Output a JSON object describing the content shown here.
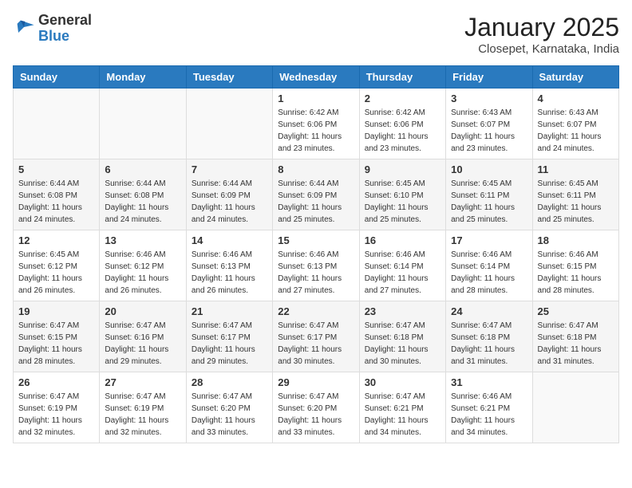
{
  "header": {
    "logo_general": "General",
    "logo_blue": "Blue",
    "main_title": "January 2025",
    "subtitle": "Closepet, Karnataka, India"
  },
  "days_of_week": [
    "Sunday",
    "Monday",
    "Tuesday",
    "Wednesday",
    "Thursday",
    "Friday",
    "Saturday"
  ],
  "weeks": [
    [
      {
        "day": "",
        "sunrise": "",
        "sunset": "",
        "daylight": ""
      },
      {
        "day": "",
        "sunrise": "",
        "sunset": "",
        "daylight": ""
      },
      {
        "day": "",
        "sunrise": "",
        "sunset": "",
        "daylight": ""
      },
      {
        "day": "1",
        "sunrise": "Sunrise: 6:42 AM",
        "sunset": "Sunset: 6:06 PM",
        "daylight": "Daylight: 11 hours and 23 minutes."
      },
      {
        "day": "2",
        "sunrise": "Sunrise: 6:42 AM",
        "sunset": "Sunset: 6:06 PM",
        "daylight": "Daylight: 11 hours and 23 minutes."
      },
      {
        "day": "3",
        "sunrise": "Sunrise: 6:43 AM",
        "sunset": "Sunset: 6:07 PM",
        "daylight": "Daylight: 11 hours and 23 minutes."
      },
      {
        "day": "4",
        "sunrise": "Sunrise: 6:43 AM",
        "sunset": "Sunset: 6:07 PM",
        "daylight": "Daylight: 11 hours and 24 minutes."
      }
    ],
    [
      {
        "day": "5",
        "sunrise": "Sunrise: 6:44 AM",
        "sunset": "Sunset: 6:08 PM",
        "daylight": "Daylight: 11 hours and 24 minutes."
      },
      {
        "day": "6",
        "sunrise": "Sunrise: 6:44 AM",
        "sunset": "Sunset: 6:08 PM",
        "daylight": "Daylight: 11 hours and 24 minutes."
      },
      {
        "day": "7",
        "sunrise": "Sunrise: 6:44 AM",
        "sunset": "Sunset: 6:09 PM",
        "daylight": "Daylight: 11 hours and 24 minutes."
      },
      {
        "day": "8",
        "sunrise": "Sunrise: 6:44 AM",
        "sunset": "Sunset: 6:09 PM",
        "daylight": "Daylight: 11 hours and 25 minutes."
      },
      {
        "day": "9",
        "sunrise": "Sunrise: 6:45 AM",
        "sunset": "Sunset: 6:10 PM",
        "daylight": "Daylight: 11 hours and 25 minutes."
      },
      {
        "day": "10",
        "sunrise": "Sunrise: 6:45 AM",
        "sunset": "Sunset: 6:11 PM",
        "daylight": "Daylight: 11 hours and 25 minutes."
      },
      {
        "day": "11",
        "sunrise": "Sunrise: 6:45 AM",
        "sunset": "Sunset: 6:11 PM",
        "daylight": "Daylight: 11 hours and 25 minutes."
      }
    ],
    [
      {
        "day": "12",
        "sunrise": "Sunrise: 6:45 AM",
        "sunset": "Sunset: 6:12 PM",
        "daylight": "Daylight: 11 hours and 26 minutes."
      },
      {
        "day": "13",
        "sunrise": "Sunrise: 6:46 AM",
        "sunset": "Sunset: 6:12 PM",
        "daylight": "Daylight: 11 hours and 26 minutes."
      },
      {
        "day": "14",
        "sunrise": "Sunrise: 6:46 AM",
        "sunset": "Sunset: 6:13 PM",
        "daylight": "Daylight: 11 hours and 26 minutes."
      },
      {
        "day": "15",
        "sunrise": "Sunrise: 6:46 AM",
        "sunset": "Sunset: 6:13 PM",
        "daylight": "Daylight: 11 hours and 27 minutes."
      },
      {
        "day": "16",
        "sunrise": "Sunrise: 6:46 AM",
        "sunset": "Sunset: 6:14 PM",
        "daylight": "Daylight: 11 hours and 27 minutes."
      },
      {
        "day": "17",
        "sunrise": "Sunrise: 6:46 AM",
        "sunset": "Sunset: 6:14 PM",
        "daylight": "Daylight: 11 hours and 28 minutes."
      },
      {
        "day": "18",
        "sunrise": "Sunrise: 6:46 AM",
        "sunset": "Sunset: 6:15 PM",
        "daylight": "Daylight: 11 hours and 28 minutes."
      }
    ],
    [
      {
        "day": "19",
        "sunrise": "Sunrise: 6:47 AM",
        "sunset": "Sunset: 6:15 PM",
        "daylight": "Daylight: 11 hours and 28 minutes."
      },
      {
        "day": "20",
        "sunrise": "Sunrise: 6:47 AM",
        "sunset": "Sunset: 6:16 PM",
        "daylight": "Daylight: 11 hours and 29 minutes."
      },
      {
        "day": "21",
        "sunrise": "Sunrise: 6:47 AM",
        "sunset": "Sunset: 6:17 PM",
        "daylight": "Daylight: 11 hours and 29 minutes."
      },
      {
        "day": "22",
        "sunrise": "Sunrise: 6:47 AM",
        "sunset": "Sunset: 6:17 PM",
        "daylight": "Daylight: 11 hours and 30 minutes."
      },
      {
        "day": "23",
        "sunrise": "Sunrise: 6:47 AM",
        "sunset": "Sunset: 6:18 PM",
        "daylight": "Daylight: 11 hours and 30 minutes."
      },
      {
        "day": "24",
        "sunrise": "Sunrise: 6:47 AM",
        "sunset": "Sunset: 6:18 PM",
        "daylight": "Daylight: 11 hours and 31 minutes."
      },
      {
        "day": "25",
        "sunrise": "Sunrise: 6:47 AM",
        "sunset": "Sunset: 6:18 PM",
        "daylight": "Daylight: 11 hours and 31 minutes."
      }
    ],
    [
      {
        "day": "26",
        "sunrise": "Sunrise: 6:47 AM",
        "sunset": "Sunset: 6:19 PM",
        "daylight": "Daylight: 11 hours and 32 minutes."
      },
      {
        "day": "27",
        "sunrise": "Sunrise: 6:47 AM",
        "sunset": "Sunset: 6:19 PM",
        "daylight": "Daylight: 11 hours and 32 minutes."
      },
      {
        "day": "28",
        "sunrise": "Sunrise: 6:47 AM",
        "sunset": "Sunset: 6:20 PM",
        "daylight": "Daylight: 11 hours and 33 minutes."
      },
      {
        "day": "29",
        "sunrise": "Sunrise: 6:47 AM",
        "sunset": "Sunset: 6:20 PM",
        "daylight": "Daylight: 11 hours and 33 minutes."
      },
      {
        "day": "30",
        "sunrise": "Sunrise: 6:47 AM",
        "sunset": "Sunset: 6:21 PM",
        "daylight": "Daylight: 11 hours and 34 minutes."
      },
      {
        "day": "31",
        "sunrise": "Sunrise: 6:46 AM",
        "sunset": "Sunset: 6:21 PM",
        "daylight": "Daylight: 11 hours and 34 minutes."
      },
      {
        "day": "",
        "sunrise": "",
        "sunset": "",
        "daylight": ""
      }
    ]
  ]
}
